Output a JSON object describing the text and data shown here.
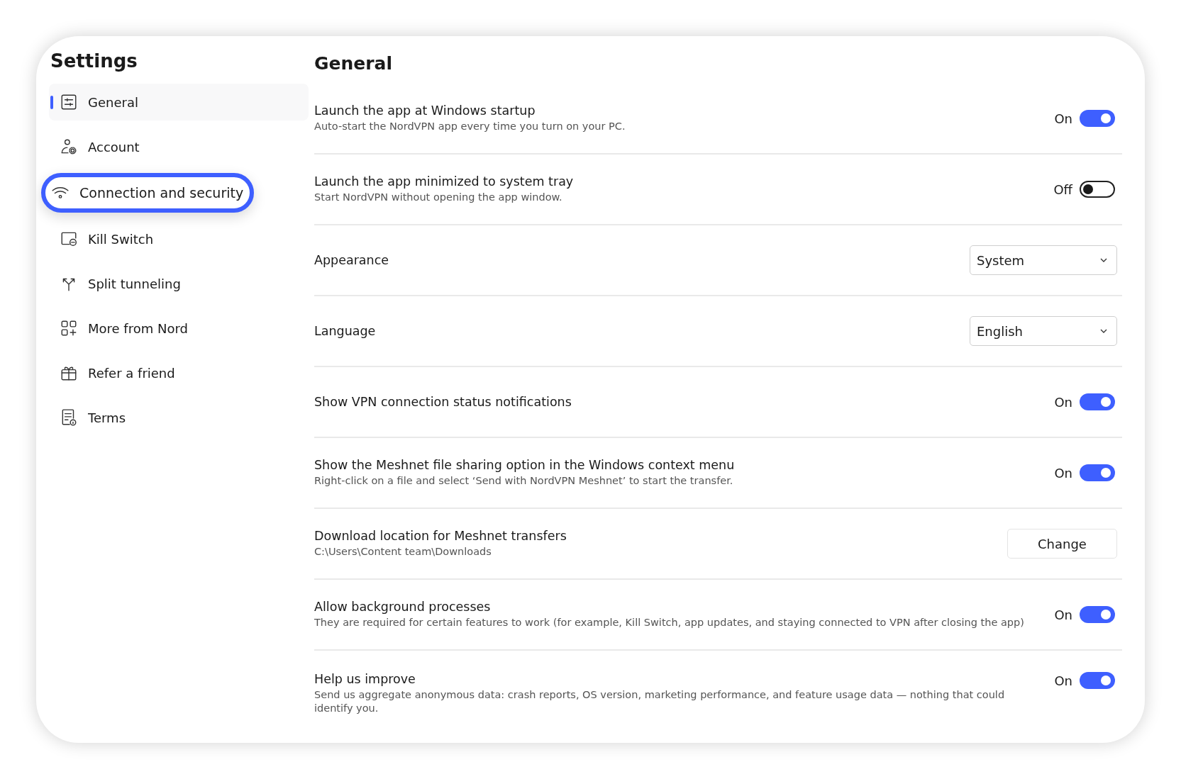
{
  "sidebar": {
    "title": "Settings",
    "items": [
      {
        "label": "General",
        "selected": true,
        "highlighted": false
      },
      {
        "label": "Account",
        "selected": false,
        "highlighted": false
      },
      {
        "label": "Connection and security",
        "selected": false,
        "highlighted": true
      },
      {
        "label": "Kill Switch",
        "selected": false,
        "highlighted": false
      },
      {
        "label": "Split tunneling",
        "selected": false,
        "highlighted": false
      },
      {
        "label": "More from Nord",
        "selected": false,
        "highlighted": false
      },
      {
        "label": "Refer a friend",
        "selected": false,
        "highlighted": false
      },
      {
        "label": "Terms",
        "selected": false,
        "highlighted": false
      }
    ]
  },
  "content": {
    "title": "General",
    "settings": [
      {
        "kind": "toggle",
        "title": "Launch the app at Windows startup",
        "description": "Auto-start the NordVPN app every time you turn on your PC.",
        "state_label": "On",
        "on": true
      },
      {
        "kind": "toggle",
        "title": "Launch the app minimized to system tray",
        "description": "Start NordVPN without opening the app window.",
        "state_label": "Off",
        "on": false
      },
      {
        "kind": "select",
        "title": "Appearance",
        "value": "System"
      },
      {
        "kind": "select",
        "title": "Language",
        "value": "English"
      },
      {
        "kind": "toggle",
        "title": "Show VPN connection status notifications",
        "state_label": "On",
        "on": true
      },
      {
        "kind": "toggle",
        "title": "Show the Meshnet file sharing option in the Windows context menu",
        "description": "Right-click on a file and select ‘Send with NordVPN Meshnet’ to start the transfer.",
        "state_label": "On",
        "on": true
      },
      {
        "kind": "button",
        "title": "Download location for Meshnet transfers",
        "description": "C:\\Users\\Content team\\Downloads",
        "button": "Change"
      },
      {
        "kind": "toggle",
        "title": "Allow background processes",
        "description": "They are required for certain features to work (for example, Kill Switch, app updates, and staying connected to VPN after closing the app)",
        "state_label": "On",
        "on": true
      },
      {
        "kind": "toggle",
        "title": "Help us improve",
        "description": "Send us aggregate anonymous data: crash reports, OS version, marketing performance, and feature usage data — nothing that could identify you.",
        "state_label": "On",
        "on": true
      }
    ]
  }
}
